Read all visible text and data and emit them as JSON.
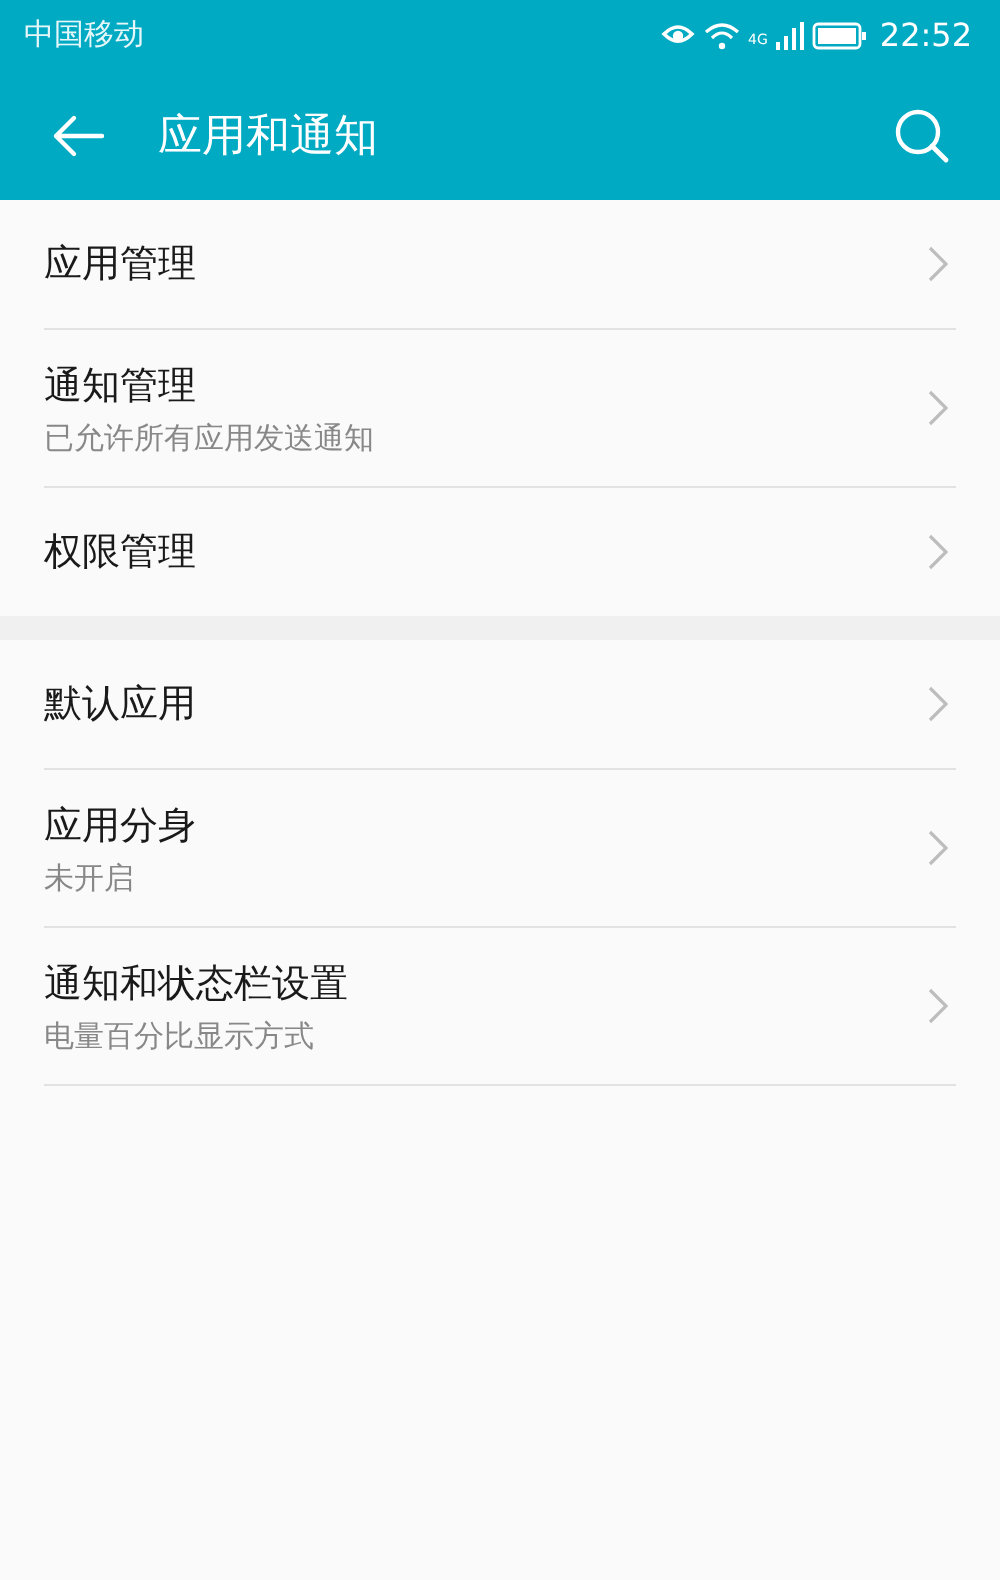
{
  "status_bar": {
    "carrier": "中国移动",
    "network": "4G",
    "time": "22:52"
  },
  "app_bar": {
    "title": "应用和通知"
  },
  "groups": [
    {
      "items": [
        {
          "title": "应用管理"
        },
        {
          "title": "通知管理",
          "subtitle": "已允许所有应用发送通知"
        },
        {
          "title": "权限管理"
        }
      ]
    },
    {
      "items": [
        {
          "title": "默认应用"
        },
        {
          "title": "应用分身",
          "subtitle": "未开启"
        },
        {
          "title": "通知和状态栏设置",
          "subtitle": "电量百分比显示方式"
        }
      ]
    }
  ]
}
